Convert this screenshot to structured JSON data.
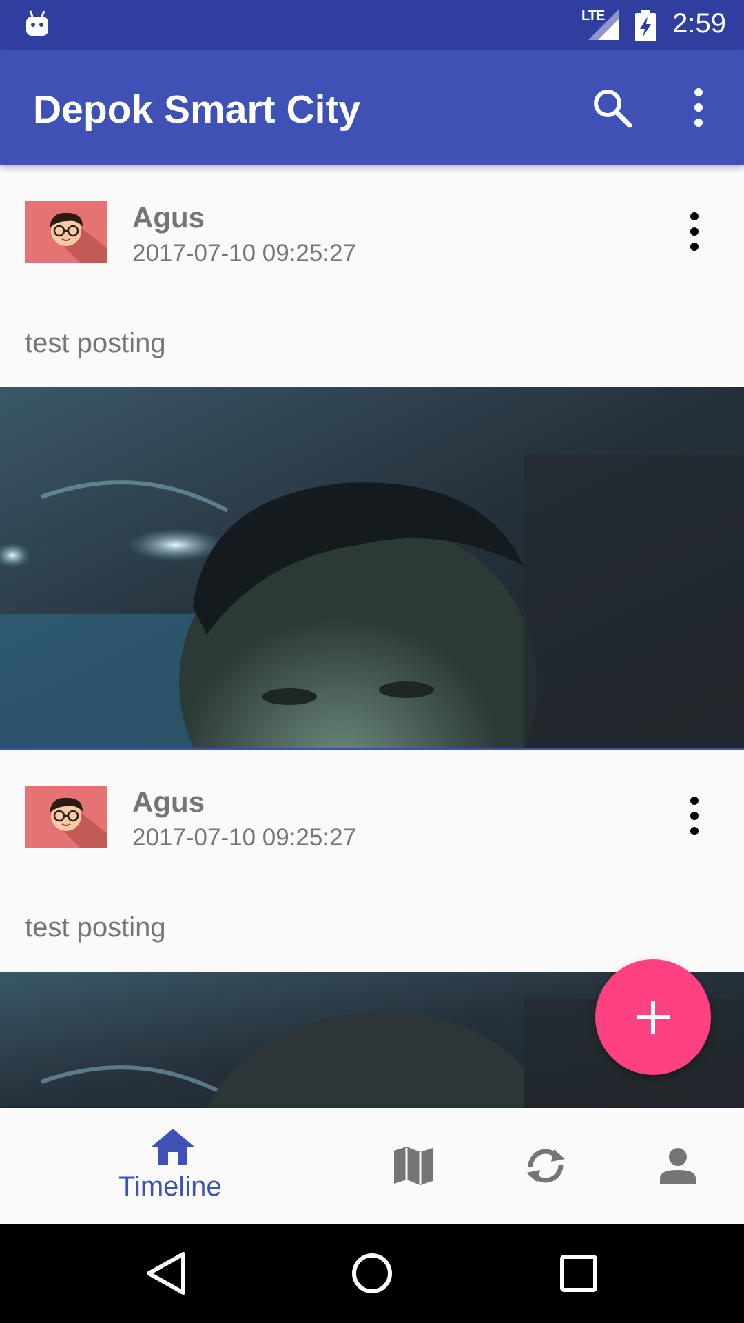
{
  "status_bar": {
    "network": "LTE",
    "time": "2:59"
  },
  "app_bar": {
    "title": "Depok Smart City",
    "search_icon": "search-icon",
    "more_icon": "more-vert-icon"
  },
  "posts": [
    {
      "author": "Agus",
      "timestamp": "2017-07-10 09:25:27",
      "text": "test posting"
    },
    {
      "author": "Agus",
      "timestamp": "2017-07-10 09:25:27",
      "text": "test posting"
    }
  ],
  "fab": {
    "icon": "add-icon"
  },
  "bottom_nav": {
    "items": [
      {
        "label": "Timeline",
        "icon": "home-icon",
        "active": true
      },
      {
        "icon": "map-icon"
      },
      {
        "icon": "sync-icon"
      },
      {
        "icon": "person-icon"
      }
    ]
  },
  "colors": {
    "primary": "#3f51b5",
    "primary_dark": "#303f9f",
    "accent": "#ff4081",
    "avatar_bg": "#e57373"
  }
}
